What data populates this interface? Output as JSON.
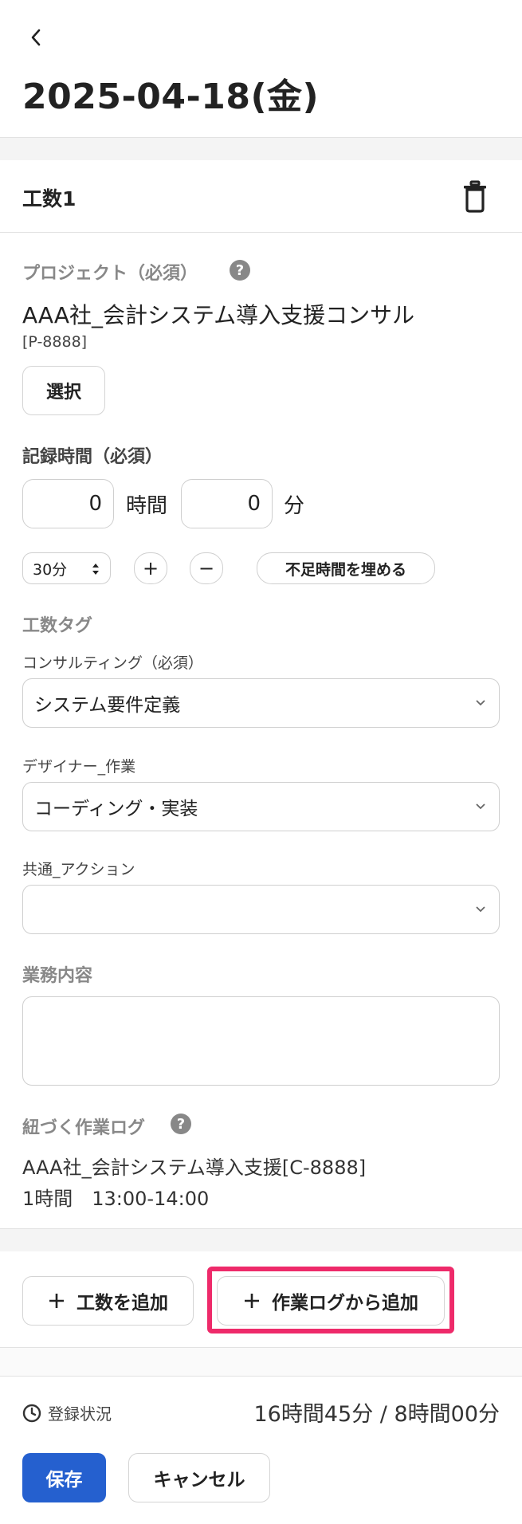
{
  "header": {
    "title": "2025-04-18(金)"
  },
  "entry": {
    "section_title": "工数1",
    "project": {
      "label": "プロジェクト（必須）",
      "name": "AAA社_会計システム導入支援コンサル",
      "code": "[P-8888]",
      "select_button": "選択"
    },
    "time": {
      "label": "記録時間（必須）",
      "hours_value": "0",
      "hours_unit": "時間",
      "minutes_value": "0",
      "minutes_unit": "分",
      "step_select": "30分",
      "plus": "+",
      "minus": "−",
      "fill_button": "不足時間を埋める"
    },
    "tags": {
      "label": "工数タグ",
      "fields": [
        {
          "label": "コンサルティング（必須）",
          "value": "システム要件定義"
        },
        {
          "label": "デザイナー_作業",
          "value": "コーディング・実装"
        },
        {
          "label": "共通_アクション",
          "value": ""
        }
      ]
    },
    "work_content": {
      "label": "業務内容",
      "value": ""
    },
    "linked_log": {
      "label": "紐づく作業ログ",
      "title": "AAA社_会計システム導入支援[C-8888]",
      "detail": "1時間　13:00-14:00"
    }
  },
  "actions": {
    "add_entry": "工数を追加",
    "add_from_log": "作業ログから追加"
  },
  "footer": {
    "status_label": "登録状況",
    "totals": "16時間45分 / 8時間00分",
    "save": "保存",
    "cancel": "キャンセル"
  },
  "colors": {
    "primary": "#2560cf",
    "highlight": "#ee2a6a",
    "label_gray": "#888888"
  }
}
